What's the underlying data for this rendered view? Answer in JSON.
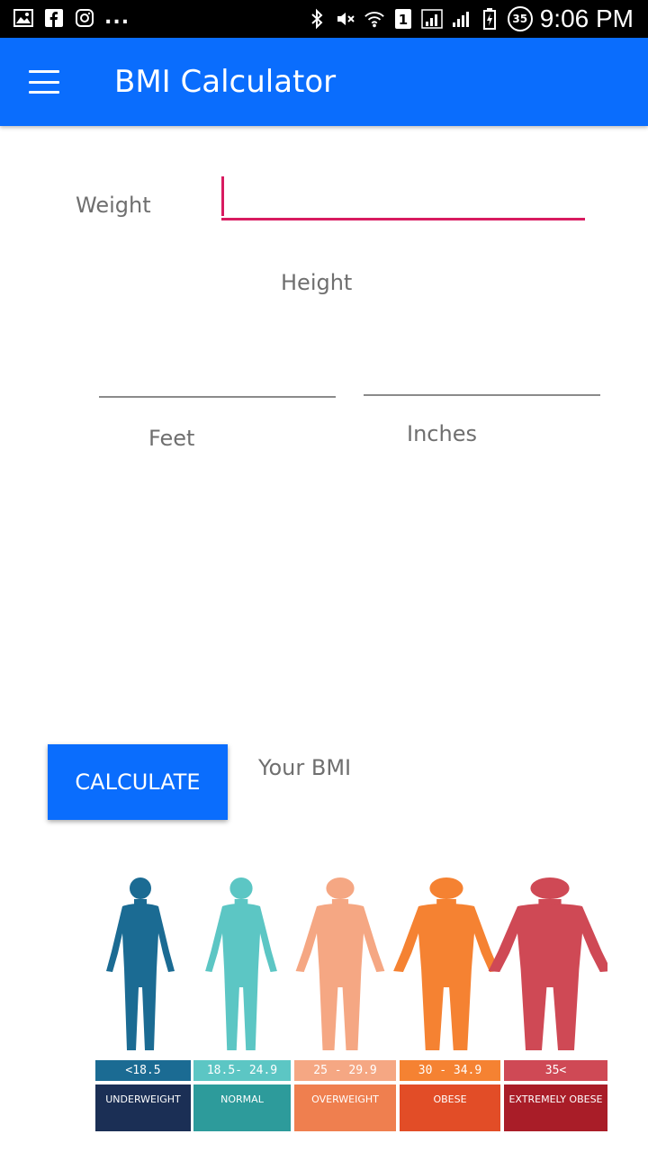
{
  "status_bar": {
    "left_icons": [
      "image-icon",
      "facebook-icon",
      "instagram-icon"
    ],
    "overflow": "...",
    "right_icons": [
      "bluetooth-icon",
      "mute-icon",
      "wifi-icon",
      "sim1-icon",
      "signal-icon",
      "signal2-icon",
      "battery-icon"
    ],
    "badge": "35",
    "time": "9:06 PM"
  },
  "app_bar": {
    "title": "BMI Calculator",
    "menu_icon": "hamburger-menu-icon",
    "background": "#0a6dfd"
  },
  "form": {
    "weight": {
      "label": "Weight",
      "value": "",
      "accent": "#d81b60"
    },
    "height": {
      "label": "Height"
    },
    "feet": {
      "label": "Feet",
      "value": ""
    },
    "inches": {
      "label": "Inches",
      "value": ""
    }
  },
  "calculate_button": {
    "label": "CALCULATE"
  },
  "result": {
    "label": "Your BMI"
  },
  "bmi_chart": {
    "categories": [
      {
        "range": "<18.5",
        "name": "UNDERWEIGHT",
        "figure_color": "#1b6b93",
        "range_color": "#1b6b93",
        "name_color": "#1b2f55"
      },
      {
        "range": "18.5- 24.9",
        "name": "NORMAL",
        "figure_color": "#5cc6c4",
        "range_color": "#5cc6c4",
        "name_color": "#2d9b9b"
      },
      {
        "range": "25 - 29.9",
        "name": "OVERWEIGHT",
        "figure_color": "#f5a783",
        "range_color": "#f5a783",
        "name_color": "#ef7f4f"
      },
      {
        "range": "30 - 34.9",
        "name": "OBESE",
        "figure_color": "#f58232",
        "range_color": "#f58232",
        "name_color": "#e24d27"
      },
      {
        "range": "35<",
        "name": "EXTREMELY OBESE",
        "figure_color": "#cf4955",
        "range_color": "#cf4955",
        "name_color": "#a91d28"
      }
    ]
  }
}
